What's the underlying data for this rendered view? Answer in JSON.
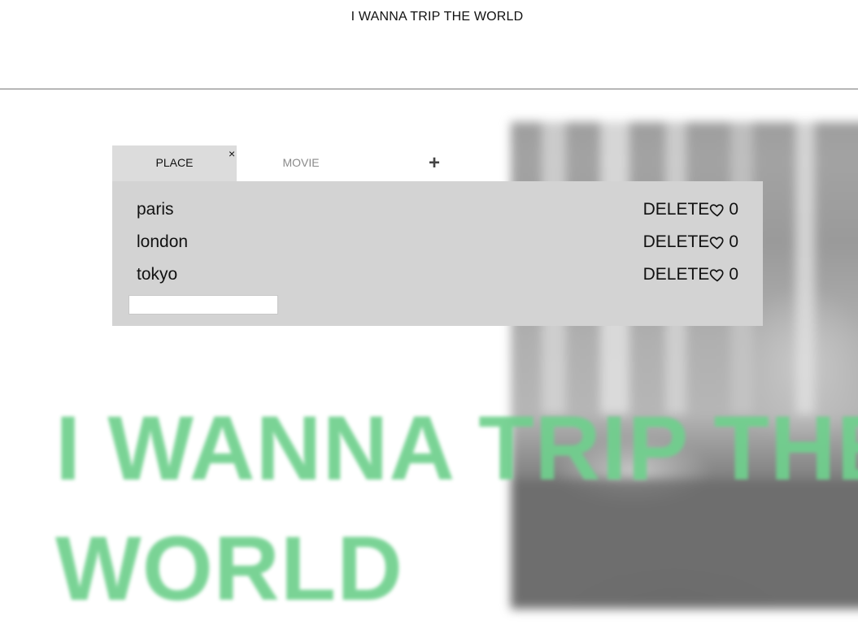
{
  "header": {
    "title": "I WANNA TRIP THE WORLD"
  },
  "tabs": [
    {
      "label": "PLACE",
      "active": true
    },
    {
      "label": "MOVIE",
      "active": false
    }
  ],
  "tab_close_glyph": "×",
  "add_tab_glyph": "+",
  "items": [
    {
      "name": "paris",
      "delete_label": "DELETE",
      "likes": "0"
    },
    {
      "name": "london",
      "delete_label": "DELETE",
      "likes": "0"
    },
    {
      "name": "tokyo",
      "delete_label": "DELETE",
      "likes": "0"
    }
  ],
  "new_item_input": {
    "value": "",
    "placeholder": ""
  },
  "hero": {
    "line1": "I WANNA TRIP THE",
    "line2": "WORLD"
  },
  "icons": {
    "heart": "heart-icon"
  },
  "colors": {
    "hero_text": "#6fd08d",
    "panel_bg": "#d3d3d3",
    "active_tab_bg": "#dcdcdc"
  }
}
